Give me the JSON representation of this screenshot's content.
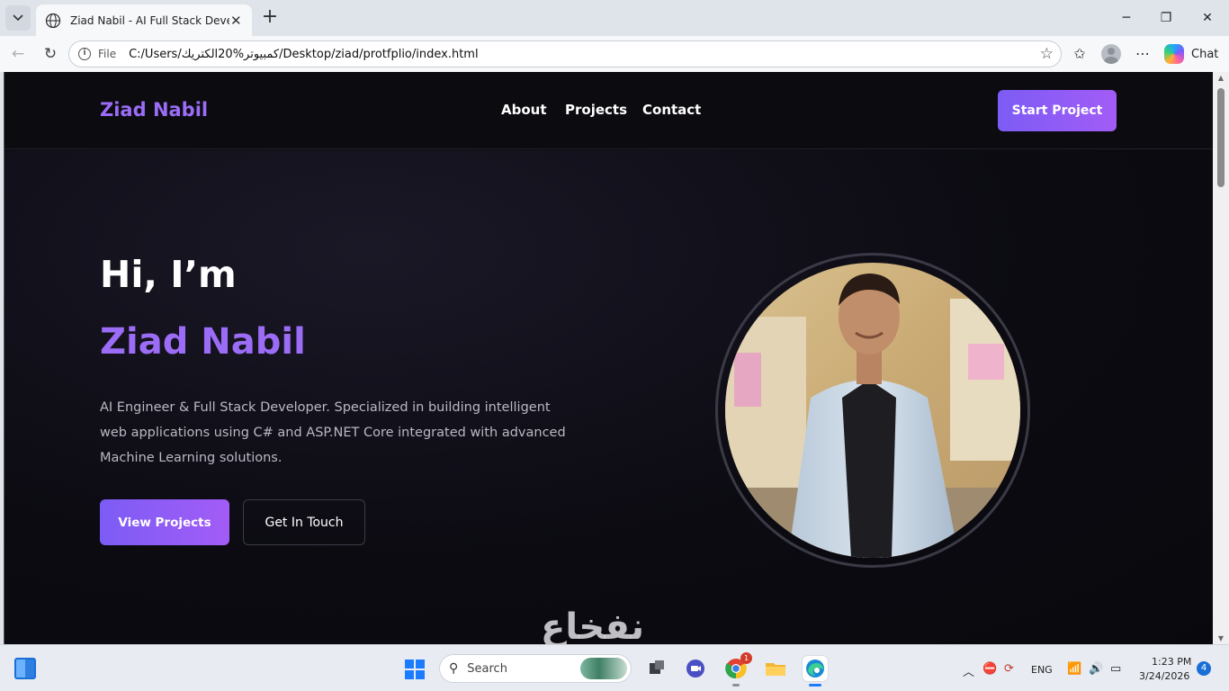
{
  "browser": {
    "tab_title": "Ziad Nabil - AI Full Stack Developer",
    "tab_close": "✕",
    "new_tab": "+",
    "url_scheme": "File",
    "url": "C:/Users/كمبيوتر%20الكتريك/Desktop/ziad/protfplio/index.html",
    "chat_label": "Chat"
  },
  "site": {
    "brand": "Ziad Nabil",
    "nav": [
      "About",
      "Projects",
      "Contact"
    ],
    "cta": "Start Project"
  },
  "hero": {
    "greeting": "Hi, I’m",
    "name": "Ziad Nabil",
    "description": "AI Engineer & Full Stack Developer. Specialized in building intelligent web applications using C# and ASP.NET Core integrated with advanced Machine Learning solutions.",
    "primary_button": "View Projects",
    "secondary_button": "Get In Touch"
  },
  "watermark": "نفخاع",
  "taskbar": {
    "search_label": "Search",
    "chrome_badge": "1",
    "language": "ENG",
    "time": "1:23 PM",
    "date": "3/24/2026",
    "notifications": "4"
  },
  "colors": {
    "accent": "#9b6cf6",
    "gradient_start": "#7c5cf5",
    "gradient_end": "#a35cf6",
    "page_bg": "#0a0a10"
  }
}
